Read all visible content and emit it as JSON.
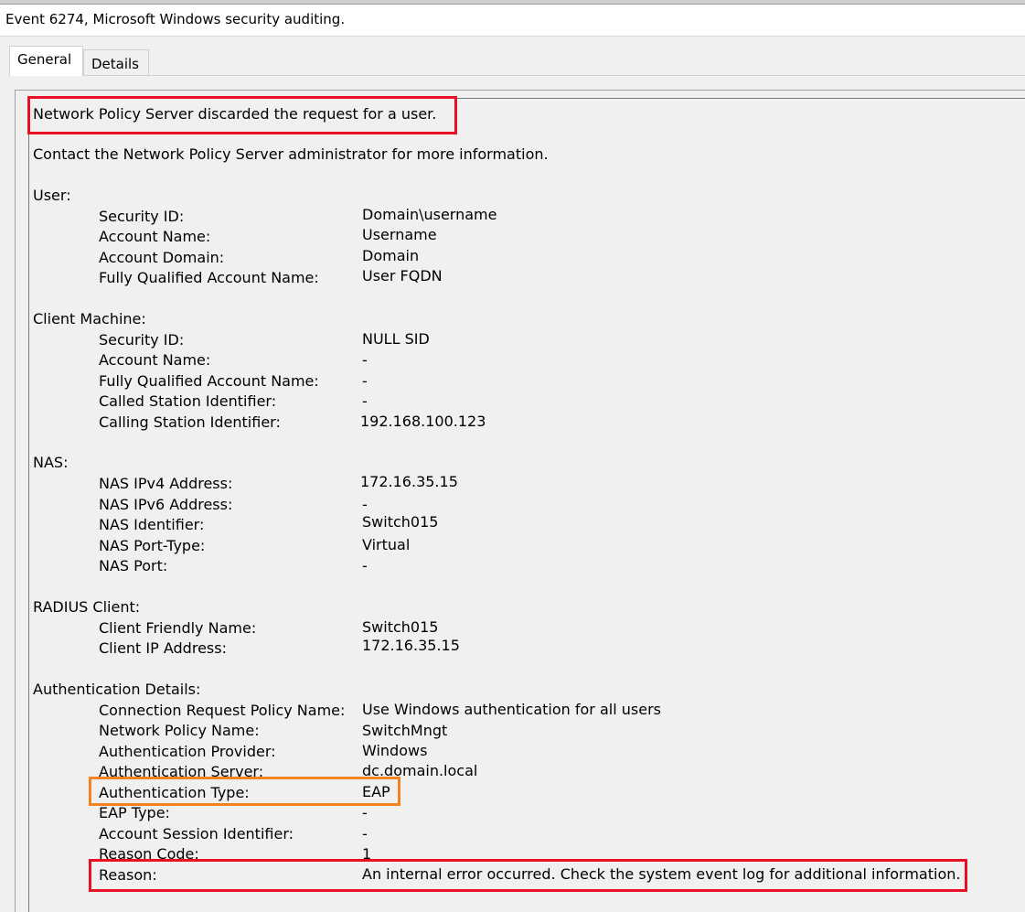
{
  "window": {
    "title": "Event 6274, Microsoft Windows security auditing."
  },
  "tabs": [
    {
      "label": "General",
      "active": true
    },
    {
      "label": "Details",
      "active": false
    }
  ],
  "event": {
    "message": "Network Policy Server discarded the request for a user.",
    "contact": "Contact the Network Policy Server administrator for more information.",
    "sections": [
      {
        "heading": "User:",
        "fields": [
          {
            "label": "Security ID:",
            "value": "Domain\\username"
          },
          {
            "label": "Account Name:",
            "value": "Username"
          },
          {
            "label": "Account Domain:",
            "value": "Domain"
          },
          {
            "label": "Fully Qualified Account Name:",
            "value": "User FQDN"
          }
        ]
      },
      {
        "heading": "Client Machine:",
        "fields": [
          {
            "label": "Security ID:",
            "value": "NULL SID"
          },
          {
            "label": "Account Name:",
            "value": "-"
          },
          {
            "label": "Fully Qualified Account Name:",
            "value": "-"
          },
          {
            "label": "Called Station Identifier:",
            "value": "-"
          },
          {
            "label": "Calling Station Identifier:",
            "value": "192.168.100.123"
          }
        ]
      },
      {
        "heading": "NAS:",
        "fields": [
          {
            "label": "NAS IPv4 Address:",
            "value": "172.16.35.15"
          },
          {
            "label": "NAS IPv6 Address:",
            "value": "-"
          },
          {
            "label": "NAS Identifier:",
            "value": "Switch015"
          },
          {
            "label": "NAS Port-Type:",
            "value": "Virtual"
          },
          {
            "label": "NAS Port:",
            "value": "-"
          }
        ]
      },
      {
        "heading": "RADIUS Client:",
        "fields": [
          {
            "label": "Client Friendly Name:",
            "value": "Switch015"
          },
          {
            "label": "Client IP Address:",
            "value": "172.16.35.15"
          }
        ]
      },
      {
        "heading": "Authentication Details:",
        "fields": [
          {
            "label": "Connection Request Policy Name:",
            "value": "Use Windows authentication for all users"
          },
          {
            "label": "Network Policy Name:",
            "value": "SwitchMngt"
          },
          {
            "label": "Authentication Provider:",
            "value": "Windows"
          },
          {
            "label": "Authentication Server:",
            "value": "dc.domain.local"
          },
          {
            "label": "Authentication Type:",
            "value": "EAP"
          },
          {
            "label": "EAP Type:",
            "value": "-"
          },
          {
            "label": "Account Session Identifier:",
            "value": "-"
          },
          {
            "label": "Reason Code:",
            "value": "1"
          },
          {
            "label": "Reason:",
            "value": "An internal error occurred. Check the system event log for additional information."
          }
        ]
      }
    ]
  },
  "annotations": {
    "red": "#e81123",
    "orange": "#f58220"
  }
}
